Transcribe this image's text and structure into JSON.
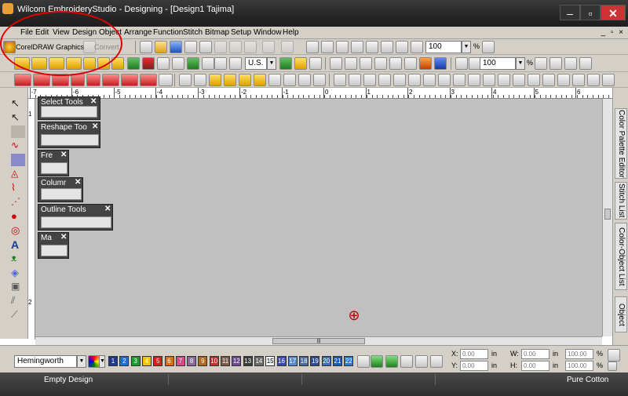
{
  "window": {
    "title": "Wilcom EmbroideryStudio - Designing - [Design1      Tajima]"
  },
  "menubar": {
    "items": [
      "File",
      "Edit",
      "View",
      "Design",
      "Object",
      "Arrange",
      "Function",
      "Stitch",
      "Bitmap",
      "Setup",
      "Window",
      "Help"
    ],
    "mdi_controls": "_ ▫ ×"
  },
  "toolbar": {
    "corel_label": "CorelDRAW Graphics",
    "convert_label": "Convert",
    "zoom_value": "100",
    "zoom_unit": "%",
    "units_value": "U.S.",
    "zoom2_value": "100",
    "zoom2_unit": "%"
  },
  "ruler": {
    "top_labels": [
      "-7",
      "-6",
      "-5",
      "-4",
      "-3",
      "-2",
      "-1",
      "0",
      "1",
      "2",
      "3",
      "4",
      "5",
      "6"
    ],
    "left_labels": [
      "1",
      "2"
    ]
  },
  "panels": [
    {
      "title": "Select Tools"
    },
    {
      "title": "Reshape Too"
    },
    {
      "title": "Fre"
    },
    {
      "title": "Columr"
    },
    {
      "title": "Outline Tools"
    },
    {
      "title": "Ma"
    }
  ],
  "docker": {
    "tabs": [
      "Color Palette Editor",
      "Stitch List",
      "Color-Object List",
      "Object"
    ]
  },
  "thread": {
    "chart_value": "Hemingworth",
    "swatches": [
      {
        "num": "1",
        "color": "#1e3a8a"
      },
      {
        "num": "2",
        "color": "#1d6fd6"
      },
      {
        "num": "3",
        "color": "#1a9a30"
      },
      {
        "num": "4",
        "color": "#e8c800"
      },
      {
        "num": "5",
        "color": "#d42020"
      },
      {
        "num": "6",
        "color": "#e06a10"
      },
      {
        "num": "7",
        "color": "#d64a8a"
      },
      {
        "num": "8",
        "color": "#8a6a9a"
      },
      {
        "num": "9",
        "color": "#b06a20"
      },
      {
        "num": "10",
        "color": "#c03030"
      },
      {
        "num": "11",
        "color": "#7a5a4a"
      },
      {
        "num": "12",
        "color": "#6a4a8a"
      },
      {
        "num": "13",
        "color": "#3a3a3a"
      },
      {
        "num": "14",
        "color": "#6a6a6a"
      },
      {
        "num": "15",
        "color": "#f4f4f4"
      },
      {
        "num": "16",
        "color": "#3a4aaa"
      },
      {
        "num": "17",
        "color": "#5a8acc"
      },
      {
        "num": "18",
        "color": "#4a6a9a"
      },
      {
        "num": "19",
        "color": "#2a4a8a"
      },
      {
        "num": "20",
        "color": "#3a6aba"
      },
      {
        "num": "21",
        "color": "#1a5ab0"
      },
      {
        "num": "22",
        "color": "#2a7ad0"
      }
    ]
  },
  "coords": {
    "x_label": "X:",
    "x_value": "0.00",
    "x_unit": "in",
    "y_label": "Y:",
    "y_value": "0.00",
    "y_unit": "in",
    "w_label": "W:",
    "w_value": "0.00",
    "w_unit": "in",
    "h_label": "H:",
    "h_value": "0.00",
    "h_unit": "in",
    "w_pct": "100.00",
    "h_pct": "100.00",
    "pct_unit": "%"
  },
  "status": {
    "left": "Empty Design",
    "right": "Pure Cotton"
  },
  "annotation_color": "#e00000"
}
